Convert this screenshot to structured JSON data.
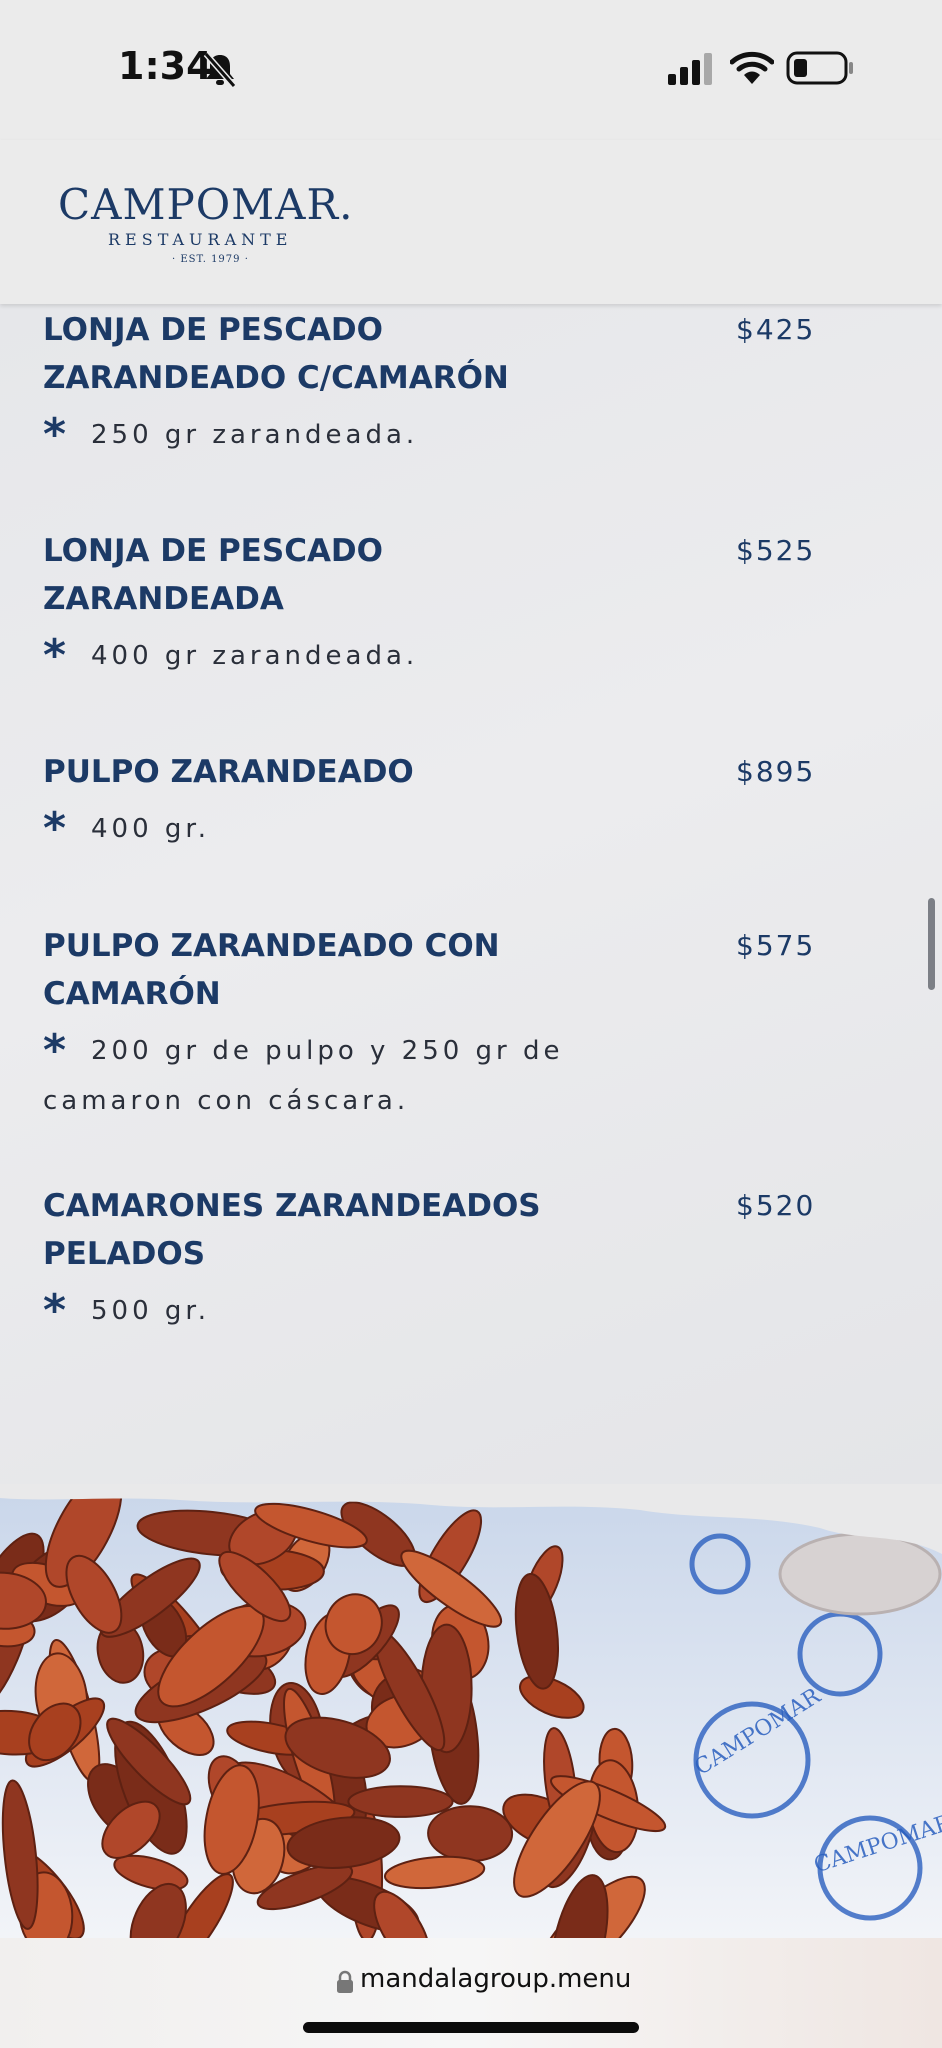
{
  "status_bar": {
    "time": "1:34",
    "icons": [
      "bell-slash-icon",
      "cellular-signal-icon",
      "wifi-icon",
      "battery-icon"
    ]
  },
  "header": {
    "logo_name": "CAMPOMAR.",
    "logo_subtitle": "RESTAURANTE",
    "logo_est": "· EST. 1979 ·"
  },
  "menu": {
    "bullet": "*",
    "items": [
      {
        "name": "LONJA DE PESCADO ZARANDEADO C/CAMARÓN",
        "price": "$425",
        "description": "250 gr zarandeada."
      },
      {
        "name": "LONJA DE PESCADO ZARANDEADA",
        "price": "$525",
        "description": "400 gr zarandeada."
      },
      {
        "name": "PULPO ZARANDEADO",
        "price": "$895",
        "description": "400 gr."
      },
      {
        "name": "PULPO ZARANDEADO CON CAMARÓN",
        "price": "$575",
        "description": "200 gr de pulpo y 250 gr de camaron con cáscara."
      },
      {
        "name": "CAMARONES ZARANDEADOS PELADOS",
        "price": "$520",
        "description": "500 gr."
      }
    ]
  },
  "photo": {
    "subject": "fried shrimp on Campomar branded paper",
    "paper_print": "CAMPOMAR"
  },
  "browser": {
    "url": "mandalagroup.menu"
  },
  "colors": {
    "brand_navy": "#1c3a66",
    "background": "#e9e9ea",
    "shrimp": "#b0472a"
  }
}
